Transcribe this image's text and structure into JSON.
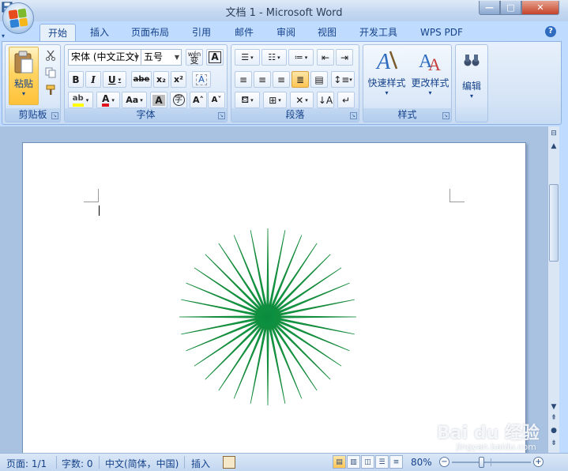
{
  "window": {
    "title": "文档 1 - Microsoft Word",
    "controls": {
      "minimize": "—",
      "maximize": "□",
      "close": "✕"
    }
  },
  "quick_access": {
    "save_icon": "save-icon",
    "undo": "↶",
    "redo": "↻",
    "print_preview_icon": "print-preview-icon",
    "customize": "▾"
  },
  "tabs": [
    {
      "label": "开始",
      "active": true
    },
    {
      "label": "插入"
    },
    {
      "label": "页面布局"
    },
    {
      "label": "引用"
    },
    {
      "label": "邮件"
    },
    {
      "label": "审阅"
    },
    {
      "label": "视图"
    },
    {
      "label": "开发工具"
    },
    {
      "label": "WPS PDF"
    }
  ],
  "help": "?",
  "ribbon": {
    "clipboard": {
      "label": "剪贴板",
      "paste": "粘贴"
    },
    "font": {
      "label": "字体",
      "font_name": "宋体 (中文正文)",
      "font_size": "五号",
      "phonetic": "wén",
      "charborder": "A",
      "bold": "B",
      "italic": "I",
      "underline": "U",
      "strikethrough": "abe",
      "subscript": "x₂",
      "superscript": "x²",
      "clear": "A",
      "highlight": "ab",
      "fontcolor": "A",
      "changecase": "Aa",
      "charshade": "A",
      "enclose": "字",
      "grow": "A˄",
      "shrink": "A˅"
    },
    "paragraph": {
      "label": "段落"
    },
    "styles": {
      "label": "样式",
      "quick_styles": "快速样式",
      "change_styles": "更改样式"
    },
    "editing": {
      "label": "编辑"
    }
  },
  "colors": {
    "star": "#0f9a47",
    "highlight": "#ffff00",
    "fontcolor": "#e0141e"
  },
  "statusbar": {
    "page": "页面: 1/1",
    "words": "字数: 0",
    "language": "中文(简体，中国)",
    "mode": "插入",
    "zoom": "80%"
  },
  "watermark": {
    "brand": "Bai du 经验",
    "url": "jingyan.baidu.com"
  }
}
